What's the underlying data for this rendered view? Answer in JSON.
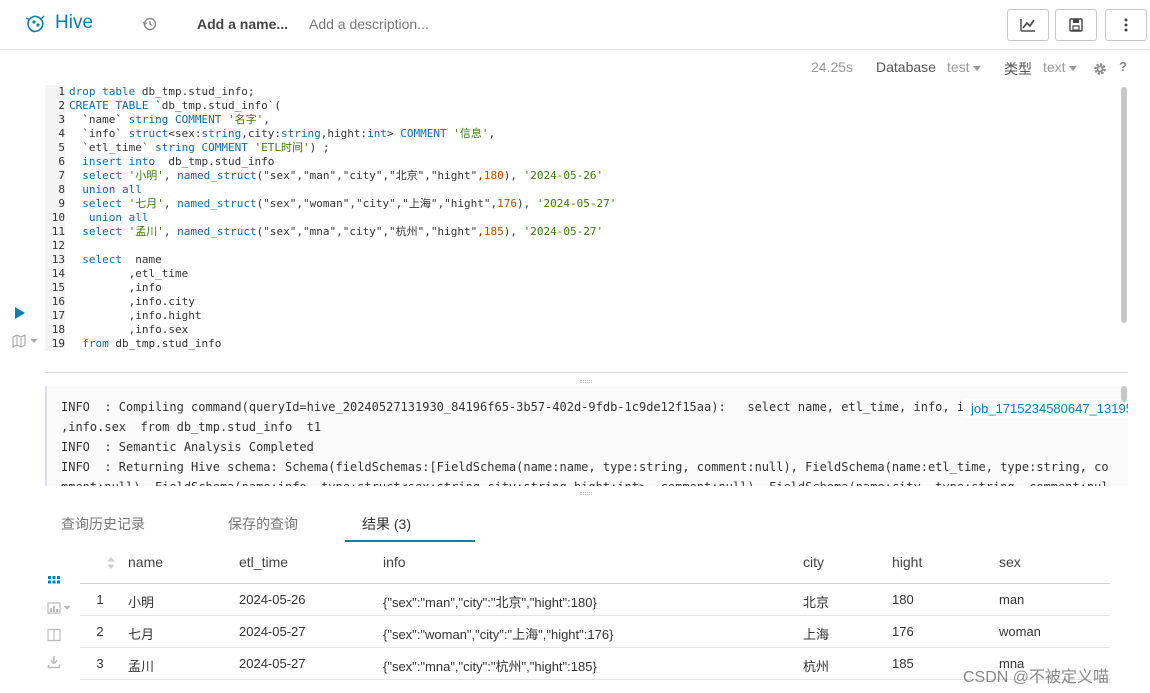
{
  "app": {
    "name": "Hive",
    "name_placeholder": "Add a name...",
    "description_placeholder": "Add a description..."
  },
  "editor_toolbar": {
    "elapsed": "24.25s",
    "database_label": "Database",
    "database_value": "test",
    "type_label": "类型",
    "type_value": "text"
  },
  "code_lines": [
    "drop table db_tmp.stud_info;",
    "CREATE TABLE `db_tmp.stud_info`(",
    "  `name` string COMMENT '名字',",
    "  `info` struct<sex:string,city:string,hight:int> COMMENT '信息',",
    "  `etl_time` string COMMENT 'ETL时间') ;",
    "  insert into  db_tmp.stud_info",
    "  select '小明', named_struct(\"sex\",\"man\",\"city\",\"北京\",\"hight\",180), '2024-05-26'",
    "  union all",
    "  select '七月', named_struct(\"sex\",\"woman\",\"city\",\"上海\",\"hight\",176), '2024-05-27'",
    "   union all",
    "  select '孟川', named_struct(\"sex\",\"mna\",\"city\",\"杭州\",\"hight\",185), '2024-05-27'",
    "",
    "  select  name",
    "         ,etl_time",
    "         ,info",
    "         ,info.city",
    "         ,info.hight",
    "         ,info.sex",
    "  from db_tmp.stud_info  t1"
  ],
  "log": {
    "lines": [
      "INFO  : Compiling command(queryId=hive_20240527131930_84196f65-3b57-402d-9fdb-1c9de12f15aa):   select name, etl_time, info, info.city, info.hight",
      ",info.sex  from db_tmp.stud_info  t1",
      "INFO  : Semantic Analysis Completed",
      "INFO  : Returning Hive schema: Schema(fieldSchemas:[FieldSchema(name:name, type:string, comment:null), FieldSchema(name:etl_time, type:string, co",
      "mment:null), FieldSchema(name:info, type:struct<sex:string,city:string,hight:int>, comment:null), FieldSchema(name:city, type:string, comment:nul"
    ],
    "job_link": "job_1715234580647_13195"
  },
  "tabs": [
    {
      "label": "查询历史记录"
    },
    {
      "label": "保存的查询"
    },
    {
      "label": "结果 (3)"
    }
  ],
  "results": {
    "columns": [
      "name",
      "etl_time",
      "info",
      "city",
      "hight",
      "sex"
    ],
    "rows": [
      {
        "idx": "1",
        "name": "小明",
        "etl_time": "2024-05-26",
        "info": "{\"sex\":\"man\",\"city\":\"北京\",\"hight\":180}",
        "city": "北京",
        "hight": "180",
        "sex": "man"
      },
      {
        "idx": "2",
        "name": "七月",
        "etl_time": "2024-05-27",
        "info": "{\"sex\":\"woman\",\"city\":\"上海\",\"hight\":176}",
        "city": "上海",
        "hight": "176",
        "sex": "woman"
      },
      {
        "idx": "3",
        "name": "孟川",
        "etl_time": "2024-05-27",
        "info": "{\"sex\":\"mna\",\"city\":\"杭州\",\"hight\":185}",
        "city": "杭州",
        "hight": "185",
        "sex": "mna"
      }
    ]
  },
  "watermark": "CSDN @不被定义喵",
  "colors": {
    "accent": "#0b7fad",
    "keyword": "#0b6ea8",
    "string": "#3c7d0a",
    "number": "#c24a00"
  },
  "icons": [
    "hive-logo-icon",
    "history-icon",
    "chart-icon",
    "save-icon",
    "more-vertical-icon",
    "gear-icon",
    "help-icon",
    "play-icon",
    "map-icon",
    "grid-icon",
    "bar-chart-icon",
    "columns-icon",
    "download-icon",
    "sort-icon"
  ]
}
